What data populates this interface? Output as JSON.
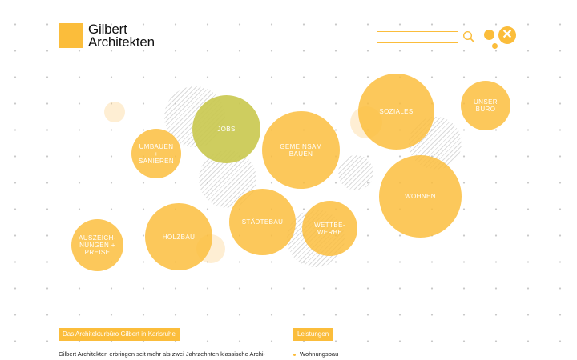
{
  "logo": {
    "line1": "Gilbert",
    "line2": "Architekten"
  },
  "search": {
    "value": "",
    "placeholder": ""
  },
  "icons": {
    "search": "search-icon",
    "close": "close-icon"
  },
  "colors": {
    "accent": "#fbbd3b",
    "green": "#c9c84e"
  },
  "bubbles": [
    {
      "id": "jobs",
      "label": "JOBS"
    },
    {
      "id": "umbauen",
      "label": "UMBAUEN\n+\nSANIEREN"
    },
    {
      "id": "gemeinsam",
      "label": "GEMEINSAM\nBAUEN"
    },
    {
      "id": "soziales",
      "label": "SOZIALES"
    },
    {
      "id": "unser-buero",
      "label": "UNSER\nBÜRO"
    },
    {
      "id": "wohnen",
      "label": "WOHNEN"
    },
    {
      "id": "staedtebau",
      "label": "STÄDTEBAU"
    },
    {
      "id": "wettbewerbe",
      "label": "WETTBE-\nWERBE"
    },
    {
      "id": "holzbau",
      "label": "HOLZBAU"
    },
    {
      "id": "auszeichnungen",
      "label": "AUSZEICH-\nNUNGEN +\nPREISE"
    }
  ],
  "intro": {
    "heading": "Das Architekturbüro Gilbert in Karlsruhe",
    "text": "Gilbert Architekten erbringen seit mehr als zwei Jahrzehnten klassische Archi-"
  },
  "services": {
    "heading": "Leistungen",
    "items": [
      "Wohnungsbau"
    ]
  }
}
